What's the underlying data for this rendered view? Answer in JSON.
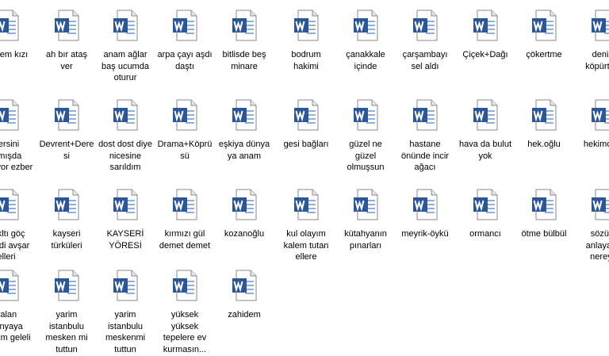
{
  "icon_name": "word-document-icon",
  "colors": {
    "word_blue": "#2b579a",
    "page_fill": "#ffffff",
    "page_border": "#8a8a8a",
    "lines": "#8fb0dc"
  },
  "files": [
    [
      "çiçcem kızı",
      "ah bır ataş ver",
      "anam ağlar baş ucumda oturur",
      "arpa çayı aşdı daştı",
      "bitlisde beş minare",
      "bodrum hakimi",
      "çanakkale içinde",
      "çarşambayı sel aldı",
      "Çiçek+Dağı",
      "çökertme",
      "denizi köpürtme"
    ],
    [
      "dersini almışda gediyor ezber",
      "Devrent+Deresi",
      "dost dost diye nicesine sarıldım",
      "Drama+Köprüsü",
      "eşkiya dünya ya anam",
      "gesi bağları",
      "güzel ne güzel olmuşsun",
      "hastane önünde incir ağacı",
      "hava da bulut yok",
      "hek.oğlu",
      "hekimoğlu"
    ],
    [
      "bakltı göç eyledi avşar elleri",
      "kayseri türküleri",
      "KAYSERİ YÖRESİ",
      "kırmızı gül demet demet",
      "kozanoğlu",
      "kul olayım kalem tutan ellere",
      "kütahyanın pınarları",
      "meyrik-öykü",
      "ormancı",
      "ötme bülbül",
      "sözüm anlayana nereye"
    ],
    [
      "yalan dünyaya geldim geleli",
      "yarim istanbulu mesken mi tuttun",
      "yarim istanbulu meskenmi tuttun",
      "yüksek yüksek tepelere ev kurmasın...",
      "zahidem"
    ]
  ]
}
